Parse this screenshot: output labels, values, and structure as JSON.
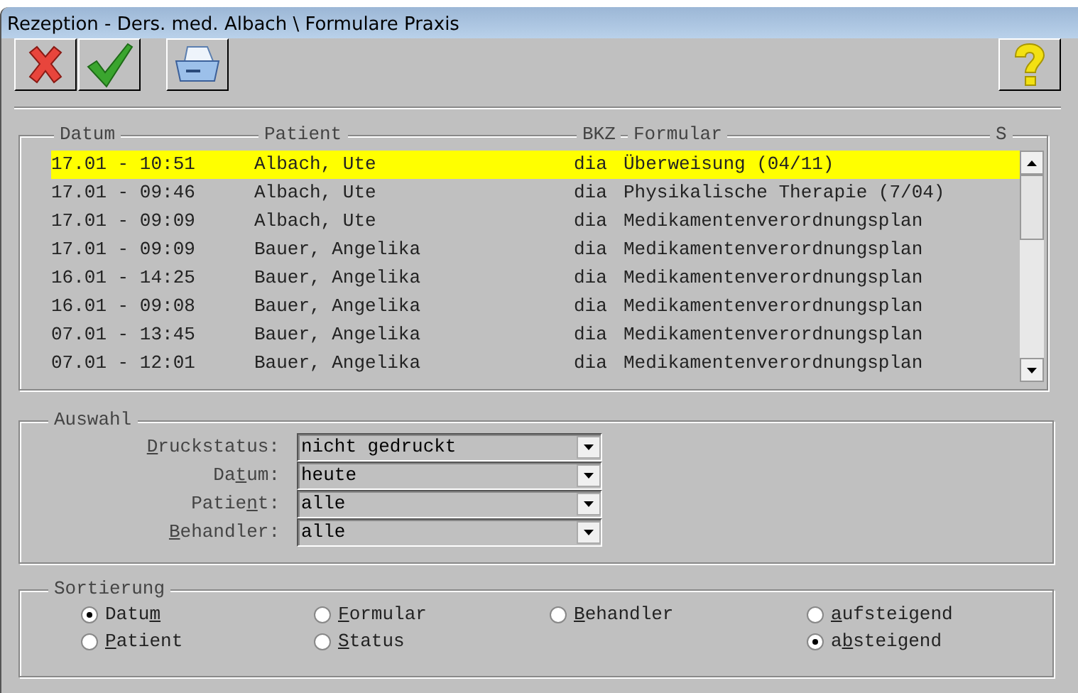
{
  "window": {
    "title": "Rezeption - Ders. med. Albach \\ Formulare Praxis"
  },
  "toolbar": [
    {
      "kind": "cancel"
    },
    {
      "kind": "ok"
    },
    {
      "kind": "print"
    },
    {
      "kind": "help"
    }
  ],
  "table": {
    "columns": [
      "Datum",
      "Patient",
      "BKZ",
      "Formular",
      "S"
    ],
    "rows": [
      {
        "selected": true,
        "cells": [
          "17.01 - 10:51",
          "Albach, Ute",
          "dia",
          "Überweisung (04/11)"
        ]
      },
      {
        "selected": false,
        "cells": [
          "17.01 - 09:46",
          "Albach, Ute",
          "dia",
          "Physikalische Therapie (7/04)"
        ]
      },
      {
        "selected": false,
        "cells": [
          "17.01 - 09:09",
          "Albach, Ute",
          "dia",
          "Medikamentenverordnungsplan"
        ]
      },
      {
        "selected": false,
        "cells": [
          "17.01 - 09:09",
          "Bauer, Angelika",
          "dia",
          "Medikamentenverordnungsplan"
        ]
      },
      {
        "selected": false,
        "cells": [
          "16.01 - 14:25",
          "Bauer, Angelika",
          "dia",
          "Medikamentenverordnungsplan"
        ]
      },
      {
        "selected": false,
        "cells": [
          "16.01 - 09:08",
          "Bauer, Angelika",
          "dia",
          "Medikamentenverordnungsplan"
        ]
      },
      {
        "selected": false,
        "cells": [
          "07.01 - 13:45",
          "Bauer, Angelika",
          "dia",
          "Medikamentenverordnungsplan"
        ]
      },
      {
        "selected": false,
        "cells": [
          "07.01 - 12:01",
          "Bauer, Angelika",
          "dia",
          "Medikamentenverordnungsplan"
        ]
      }
    ]
  },
  "auswahl": {
    "title": "Auswahl",
    "filters": [
      {
        "hotkey": "D",
        "label_after": "ruckstatus:",
        "value": "nicht gedruckt"
      },
      {
        "label_before": "Da",
        "hotkey": "t",
        "label_after": "um:",
        "value": "heute"
      },
      {
        "label_before": "Patie",
        "hotkey": "n",
        "label_after": "t:",
        "value": "alle"
      },
      {
        "hotkey": "B",
        "label_after": "ehandler:",
        "value": "alle"
      }
    ]
  },
  "sortierung": {
    "title": "Sortierung",
    "columns": [
      [
        {
          "label_before": "Datu",
          "hotkey": "m",
          "selected": true
        },
        {
          "hotkey": "P",
          "label_after": "atient",
          "selected": false
        }
      ],
      [
        {
          "hotkey": "F",
          "label_after": "ormular",
          "selected": false
        },
        {
          "hotkey": "S",
          "label_after": "tatus",
          "selected": false
        }
      ],
      [
        {
          "hotkey": "B",
          "label_after": "ehandler",
          "selected": false
        }
      ],
      [
        {
          "hotkey": "a",
          "label_after": "ufsteigend",
          "selected": false
        },
        {
          "label_before": "a",
          "hotkey": "b",
          "label_after": "steigend",
          "selected": true
        }
      ]
    ]
  }
}
